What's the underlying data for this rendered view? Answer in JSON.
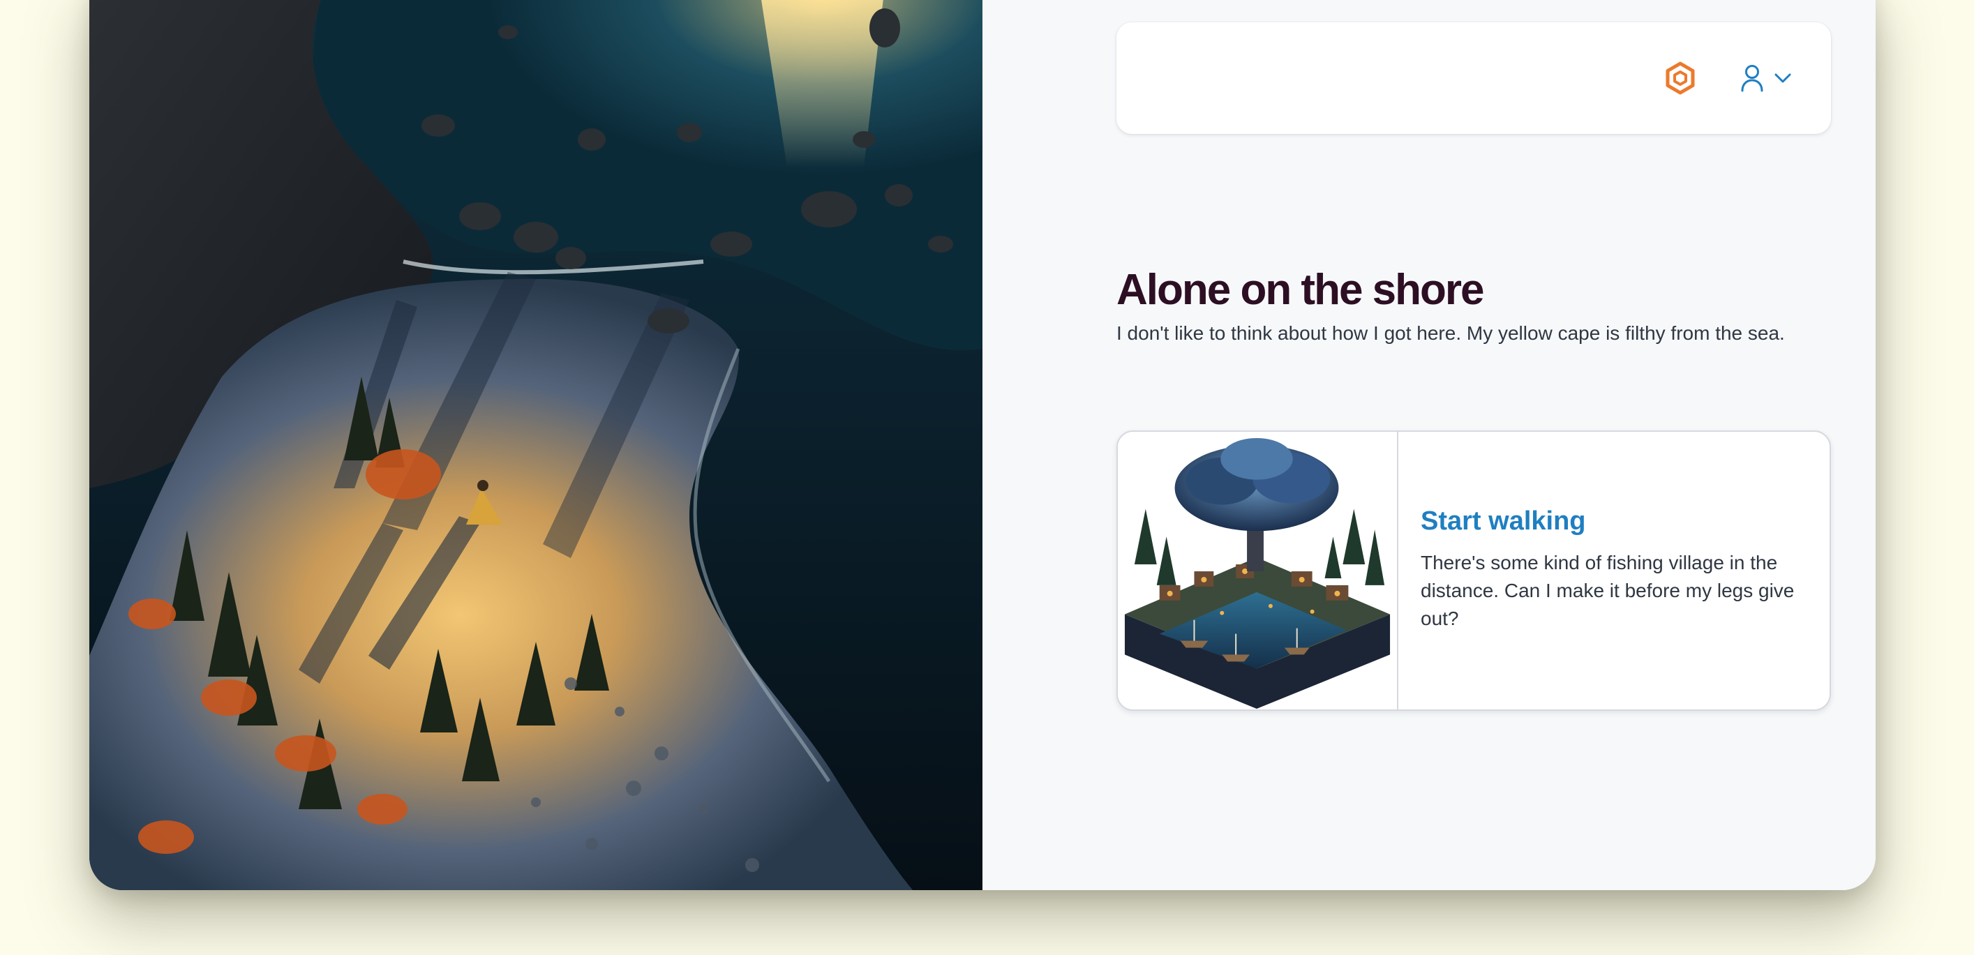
{
  "header": {
    "logo_icon": "hexagon-logo-icon",
    "logo_color": "#ec7a2c",
    "user_icon": "user-icon",
    "menu_icon": "chevron-down-icon",
    "accent_color": "#1f7fc1"
  },
  "main": {
    "title": "Alone on the shore",
    "subtitle": "I don't like to think about how I got here. My yellow cape is filthy from the sea."
  },
  "choice": {
    "title": "Start walking",
    "description": "There's some kind of fishing village in the distance. Can I make it before my legs give out?"
  },
  "colors": {
    "title": "#2d0f24",
    "page_background": "#fdfcea"
  }
}
